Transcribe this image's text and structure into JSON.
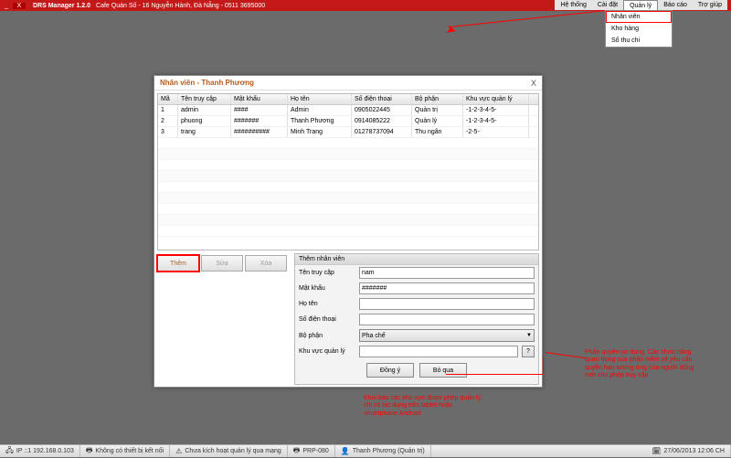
{
  "title": {
    "app": "DRS Manager 1.2.0",
    "info": "Cafe Quán Số   - 16 Nguyễn Hành, Đà Nẵng - 0511 3695000"
  },
  "menu": {
    "items": [
      "Hệ thống",
      "Cài đặt",
      "Quản lý",
      "Báo cáo",
      "Trợ giúp"
    ],
    "active": 2
  },
  "dropdown": {
    "items": [
      "Nhân viên",
      "Kho hàng",
      "Sổ thu chi"
    ],
    "selected": 0
  },
  "dialog": {
    "title": "Nhân viên - Thanh Phương",
    "cols": [
      "Mã",
      "Tên truy cập",
      "Mật khẩu",
      "Họ tên",
      "Số điện thoại",
      "Bộ phận",
      "Khu vực quản lý"
    ],
    "rows": [
      {
        "ma": "1",
        "tc": "admin",
        "mk": "####",
        "ht": "Admin",
        "dt": "0905022445",
        "bp": "Quản trị",
        "kv": "-1-2-3-4-5-"
      },
      {
        "ma": "2",
        "tc": "phuong",
        "mk": "#######",
        "ht": "Thanh Phương",
        "dt": "0914085222",
        "bp": "Quản lý",
        "kv": "-1-2-3-4-5-"
      },
      {
        "ma": "3",
        "tc": "trang",
        "mk": "##########",
        "ht": "Minh Trang",
        "dt": "01278737094",
        "bp": "Thu ngân",
        "kv": "-2-5-"
      }
    ],
    "btns": {
      "them": "Thêm",
      "sua": "Sửa",
      "xoa": "Xóa"
    },
    "form": {
      "title": "Thêm nhân viên",
      "labels": {
        "tc": "Tên truy cập",
        "mk": "Mật khẩu",
        "ht": "Họ tên",
        "dt": "Số điện thoại",
        "bp": "Bộ phận",
        "kv": "Khu vực quản lý"
      },
      "values": {
        "tc": "nam",
        "mk": "#######",
        "ht": "",
        "dt": "",
        "bp": "Pha chế",
        "kv": ""
      },
      "ok": "Đồng ý",
      "cancel": "Bỏ qua",
      "q": "?"
    }
  },
  "anno": {
    "a1": "Khai báo các khu vực được phép quản lý, chỉ có tác dụng trên tablet hoặc smartphone Android",
    "a2": "Phân quyền sử dụng. Các chức năng quan trọng của phần mềm sẽ yêu cầu quyền hạn tương ứng của người dùng mới cho phép truy cập"
  },
  "status": {
    "ip": "IP ::1 192.168.0.103",
    "dev": "Không có thiết bị kết nối",
    "net": "Chưa kích hoạt quản lý qua mạng",
    "prp": "PRP-080",
    "user": "Thanh Phương (Quản trị)",
    "time": "27/06/2013 12:06 CH"
  }
}
